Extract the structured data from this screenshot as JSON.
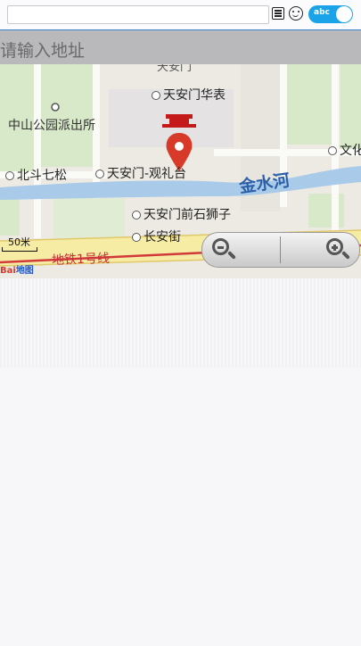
{
  "input_bar": {
    "value": "",
    "toggle_label": "abc"
  },
  "address_header": {
    "placeholder": "请输入地址"
  },
  "map": {
    "labels": {
      "top_partial": "天安门",
      "huabiao": "天安门华表",
      "police": "中山公园派出所",
      "wen": "文化",
      "beidou": "北斗七松",
      "guanlitai": "天安门-观礼台",
      "river": "金水河",
      "shizi": "天安门前石狮子",
      "changanjie": "长安街",
      "metro": "地铁1号线"
    },
    "scale_label": "50米",
    "logo": {
      "red": "Bai",
      "blue": "地图"
    },
    "colors": {
      "pin": "#d83a2a",
      "river": "#a9cbe9",
      "road": "#f6eca3",
      "metro": "#d23a3a"
    }
  },
  "zoom_controls": {
    "out_icon": "zoom-out-icon",
    "in_icon": "zoom-in-icon"
  }
}
